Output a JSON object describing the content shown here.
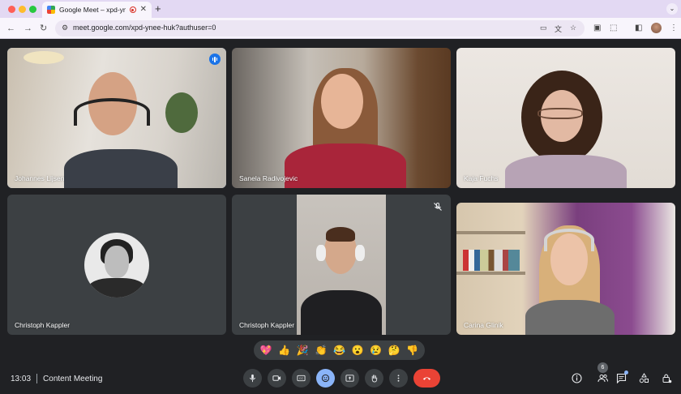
{
  "browser": {
    "tab_title": "Google Meet – xpd-ynee-huk",
    "url": "meet.google.com/xpd-ynee-huk?authuser=0"
  },
  "participants": [
    {
      "name": "Johannes Lijsen",
      "speaking": true,
      "muted": false,
      "video": true
    },
    {
      "name": "Sanela Radivojevic",
      "speaking": false,
      "muted": false,
      "video": true
    },
    {
      "name": "Kaja Fuchs",
      "speaking": false,
      "muted": false,
      "video": true
    },
    {
      "name": "Christoph Kappler",
      "speaking": false,
      "muted": false,
      "video": false
    },
    {
      "name": "Christoph Kappler",
      "speaking": false,
      "muted": true,
      "video": true
    },
    {
      "name": "Carina Glinik",
      "speaking": false,
      "muted": false,
      "video": true
    }
  ],
  "reactions": [
    "💖",
    "👍",
    "🎉",
    "👏",
    "😂",
    "😮",
    "😢",
    "🤔",
    "👎"
  ],
  "meeting": {
    "time": "13:03",
    "title": "Content Meeting",
    "participant_count": "6"
  },
  "controls": [
    "mic-icon",
    "camera-icon",
    "captions-icon",
    "emoji-icon",
    "present-icon",
    "raise-hand-icon",
    "more-icon",
    "end-call-icon"
  ],
  "side_controls": [
    "info-icon",
    "people-icon",
    "chat-icon",
    "activities-icon",
    "host-controls-icon"
  ],
  "colors": {
    "background": "#202124",
    "tile_bg": "#3c4043",
    "accent": "#8ab4f8",
    "end_call": "#ea4335",
    "tab_strip": "#e3d9f3"
  }
}
